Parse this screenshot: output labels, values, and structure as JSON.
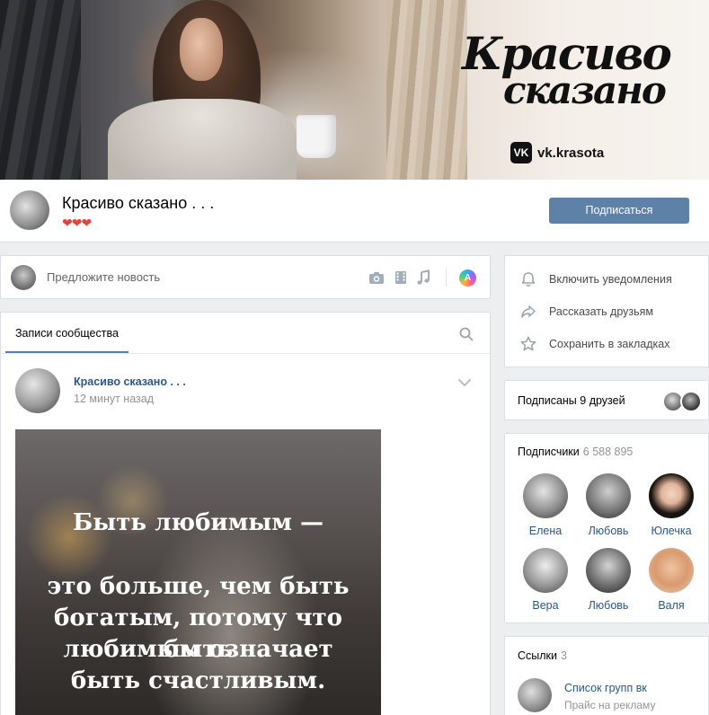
{
  "cover": {
    "brand_line1": "Красиво",
    "brand_line2": "сказано",
    "vk_label": "vk.krasota",
    "vk_logo_text": "VK"
  },
  "header": {
    "title": "Красиво сказано . . .",
    "hearts": "❤❤❤",
    "subscribe_label": "Подписаться"
  },
  "suggest": {
    "placeholder": "Предложите новость",
    "icons": [
      "camera-icon",
      "video-icon",
      "music-icon",
      "ai-assistant-icon"
    ],
    "ai_badge": "A"
  },
  "wall": {
    "tab_label": "Записи сообщества",
    "post": {
      "author": "Красиво сказано . . .",
      "time": "12 минут назад",
      "quote_lines": [
        "Быть любимым —",
        "",
        "это больше, чем быть",
        "богатым, потому что быть",
        "любимым означает",
        "быть счастливым."
      ]
    }
  },
  "actions": [
    {
      "label": "Включить уведомления",
      "icon": "bell-icon"
    },
    {
      "label": "Рассказать друзьям",
      "icon": "share-icon"
    },
    {
      "label": "Сохранить в закладках",
      "icon": "star-icon"
    }
  ],
  "friends": {
    "label": "Подписаны 9 друзей"
  },
  "subscribers": {
    "title": "Подписчики",
    "count": "6 588 895",
    "people": [
      {
        "name": "Елена"
      },
      {
        "name": "Любовь"
      },
      {
        "name": "Юлечка"
      },
      {
        "name": "Вера"
      },
      {
        "name": "Любовь"
      },
      {
        "name": "Валя"
      }
    ]
  },
  "links": {
    "title": "Ссылки",
    "count": "3",
    "item_name": "Список групп вк",
    "item_sub": "Прайс на рекламу"
  },
  "colors": {
    "accent": "#5e81a8",
    "link": "#2a5885",
    "muted": "#939393",
    "background": "#edeef0",
    "hearts": "#e0443a"
  }
}
